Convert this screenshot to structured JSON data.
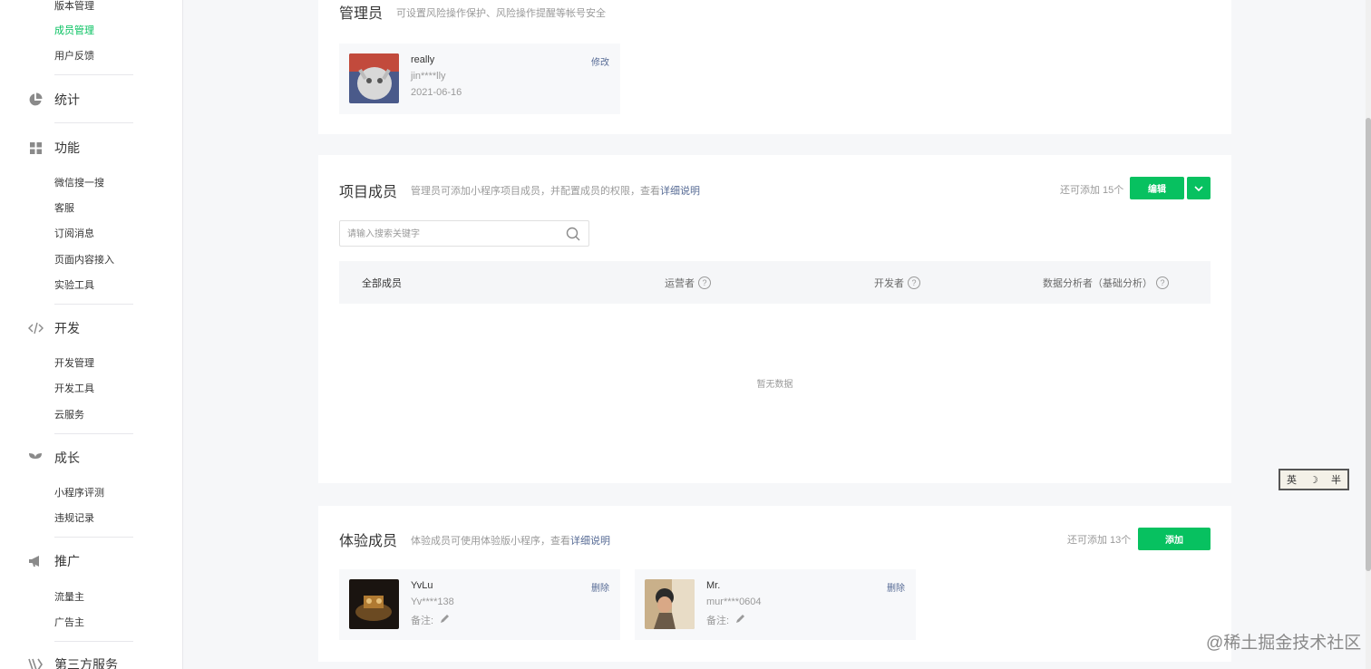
{
  "sidebar": {
    "top_items": [
      "版本管理",
      "成员管理",
      "用户反馈"
    ],
    "sections": [
      {
        "title": "统计",
        "icon": "pie-chart-icon",
        "items": []
      },
      {
        "title": "功能",
        "icon": "grid-icon",
        "items": [
          "微信搜一搜",
          "客服",
          "订阅消息",
          "页面内容接入",
          "实验工具"
        ]
      },
      {
        "title": "开发",
        "icon": "code-icon",
        "items": [
          "开发管理",
          "开发工具",
          "云服务"
        ]
      },
      {
        "title": "成长",
        "icon": "sprout-icon",
        "items": [
          "小程序评测",
          "违规记录"
        ]
      },
      {
        "title": "推广",
        "icon": "megaphone-icon",
        "items": [
          "流量主",
          "广告主"
        ]
      },
      {
        "title": "第三方服务",
        "icon": "third-party-icon",
        "items": []
      }
    ],
    "active_color": "#07c160"
  },
  "admin": {
    "title": "管理员",
    "desc": "可设置风险操作保护、风险操作提醒等帐号安全",
    "member": {
      "nick": "really",
      "account": "jin****lly",
      "date": "2021-06-16",
      "action": "修改"
    }
  },
  "project": {
    "title": "项目成员",
    "desc": "管理员可添加小程序项目成员，并配置成员的权限，查看",
    "desc_link": "详细说明",
    "quota": "还可添加 15个",
    "edit_label": "编辑",
    "search_placeholder": "请输入搜索关键字",
    "columns": [
      "全部成员",
      "运营者",
      "开发者",
      "数据分析者（基础分析）"
    ],
    "empty": "暂无数据"
  },
  "experience": {
    "title": "体验成员",
    "desc": "体验成员可使用体验版小程序，查看",
    "desc_link": "详细说明",
    "quota": "还可添加 13个",
    "add_label": "添加",
    "members": [
      {
        "nick": "YvLu",
        "account": "Yv****138",
        "note_label": "备注:",
        "action": "删除"
      },
      {
        "nick": "Mr.",
        "account": "mur****0604",
        "note_label": "备注:",
        "action": "删除"
      }
    ]
  },
  "ime": {
    "lang": "英",
    "mode": "☽",
    "width": "半"
  },
  "watermark": "@稀土掘金技术社区",
  "colors": {
    "green": "#07c160",
    "link": "#576b95",
    "muted": "#9a9a9a"
  }
}
